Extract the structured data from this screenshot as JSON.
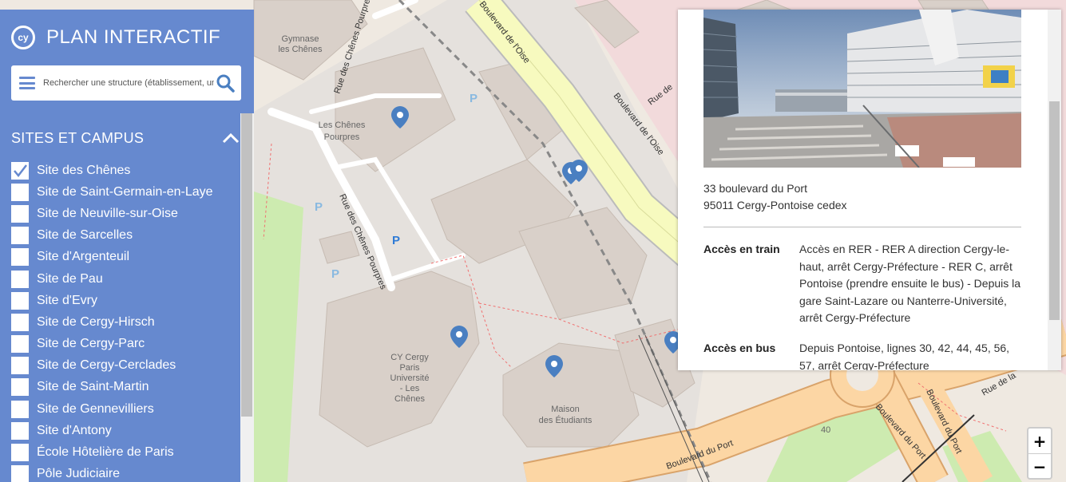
{
  "brand": {
    "logo_text": "cy",
    "title": "PLAN INTERACTIF"
  },
  "search": {
    "placeholder": "Rechercher une structure (établissement, un"
  },
  "sites_section": {
    "title": "SITES ET CAMPUS",
    "items": [
      {
        "label": "Site des Chênes",
        "checked": true
      },
      {
        "label": "Site de Saint-Germain-en-Laye",
        "checked": false
      },
      {
        "label": "Site de Neuville-sur-Oise",
        "checked": false
      },
      {
        "label": "Site de Sarcelles",
        "checked": false
      },
      {
        "label": "Site d'Argenteuil",
        "checked": false
      },
      {
        "label": "Site de Pau",
        "checked": false
      },
      {
        "label": "Site d'Evry",
        "checked": false
      },
      {
        "label": "Site de Cergy-Hirsch",
        "checked": false
      },
      {
        "label": "Site de Cergy-Parc",
        "checked": false
      },
      {
        "label": "Site de Cergy-Cerclades",
        "checked": false
      },
      {
        "label": "Site de Saint-Martin",
        "checked": false
      },
      {
        "label": "Site de Gennevilliers",
        "checked": false
      },
      {
        "label": "Site d'Antony",
        "checked": false
      },
      {
        "label": "École Hôtelière de Paris",
        "checked": false
      },
      {
        "label": "Pôle Judiciaire",
        "checked": false
      }
    ]
  },
  "info_panel": {
    "address_line1": "33 boulevard du Port",
    "address_line2": "95011 Cergy-Pontoise cedex",
    "access": [
      {
        "label": "Accès en train",
        "text": "Accès en RER - RER A direction Cergy-le-haut, arrêt Cergy-Préfecture - RER C, arrêt Pontoise (prendre ensuite le bus) - Depuis la gare Saint-Lazare ou Nanterre-Université, arrêt Cergy-Préfecture"
      },
      {
        "label": "Accès en bus",
        "text": "Depuis Pontoise, lignes 30, 42, 44, 45, 56, 57, arrêt Cergy-Préfecture"
      }
    ]
  },
  "map": {
    "labels": {
      "gymnase": [
        "Gymnase",
        "les Chênes"
      ],
      "chenes_pourpres": [
        "Les Chênes",
        "Pourpres"
      ],
      "cy_cergy": [
        "CY Cergy",
        "Paris",
        "Université",
        "- Les",
        "Chênes"
      ],
      "maison": [
        "Maison",
        "des Étudiants"
      ],
      "rue_chenes_pourpres": "Rue des Chênes Pourpres",
      "boulevard_oise": "Boulevard de l'Oise",
      "rue_de": "Rue de",
      "boulevard_port": "Boulevard du Port",
      "rue_de_la": "Rue de la",
      "parking": "P",
      "number_40": "40"
    }
  },
  "zoom": {
    "in": "+",
    "out": "−"
  },
  "colors": {
    "sidebar": "#6689cf",
    "marker": "#4a7fc1",
    "accent": "#2f7bd6"
  }
}
